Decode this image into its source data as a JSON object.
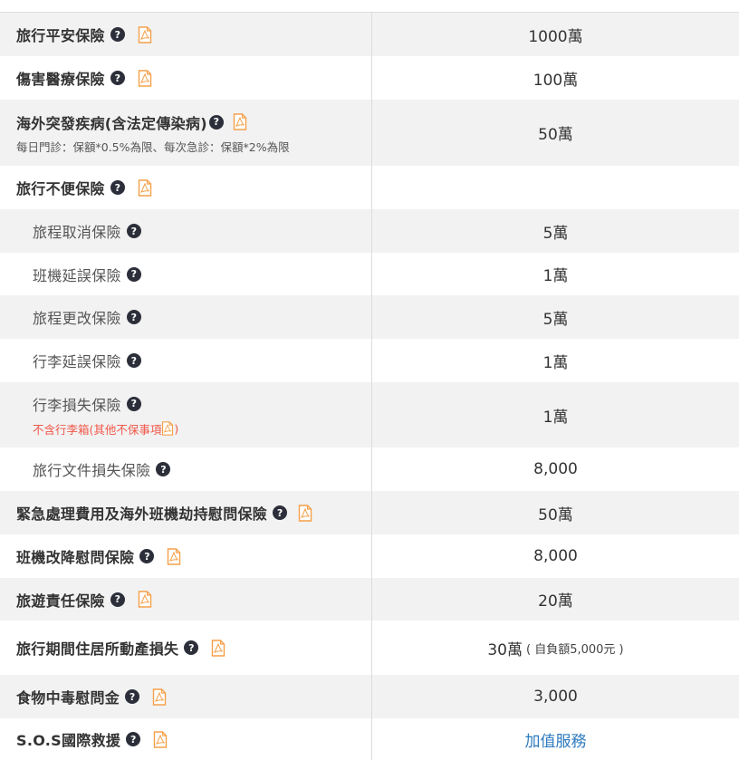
{
  "rows": [
    {
      "title": "旅行平安保險",
      "value": "1000萬",
      "pdf": true
    },
    {
      "title": "傷害醫療保險",
      "value": "100萬",
      "pdf": true
    },
    {
      "title": "海外突發疾病(含法定傳染病)",
      "note": "每日門診：保額*0.5%為限、每次急診：保額*2%為限",
      "value": "50萬",
      "pdf": true
    },
    {
      "title": "旅行不便保險",
      "value": "",
      "pdf": true
    },
    {
      "title": "旅程取消保險",
      "value": "5萬",
      "pdf": false
    },
    {
      "title": "班機延誤保險",
      "value": "1萬",
      "pdf": false
    },
    {
      "title": "旅程更改保險",
      "value": "5萬",
      "pdf": false
    },
    {
      "title": "行李延誤保險",
      "value": "1萬",
      "pdf": false
    },
    {
      "title": "行李損失保險",
      "warn": "不含行李箱(其他不保事項",
      "warn_end": ")",
      "value": "1萬",
      "pdf": false
    },
    {
      "title": "旅行文件損失保險",
      "value": "8,000",
      "pdf": false
    },
    {
      "title": "緊急處理費用及海外班機劫持慰問保險",
      "value": "50萬",
      "pdf": true
    },
    {
      "title": "班機改降慰問保險",
      "value": "8,000",
      "pdf": true
    },
    {
      "title": "旅遊責任保險",
      "value": "20萬",
      "pdf": true
    },
    {
      "title": "旅行期間住居所動產損失",
      "value": "30萬",
      "deductible": "( 自負額5,000元 )",
      "pdf": true
    },
    {
      "title": "食物中毒慰問金",
      "value": "3,000",
      "pdf": true
    },
    {
      "title": "S.O.S國際救援",
      "value": "加值服務",
      "pdf": true
    }
  ],
  "icons": {
    "help": "question-circle-icon",
    "pdf": "pdf-file-icon"
  },
  "colors": {
    "pdf_icon": "#f5a04a",
    "link": "#2e7bbf",
    "warning": "#f0584a",
    "help_icon": "#2c2f3a",
    "row_alt": "#f2f2f2"
  }
}
